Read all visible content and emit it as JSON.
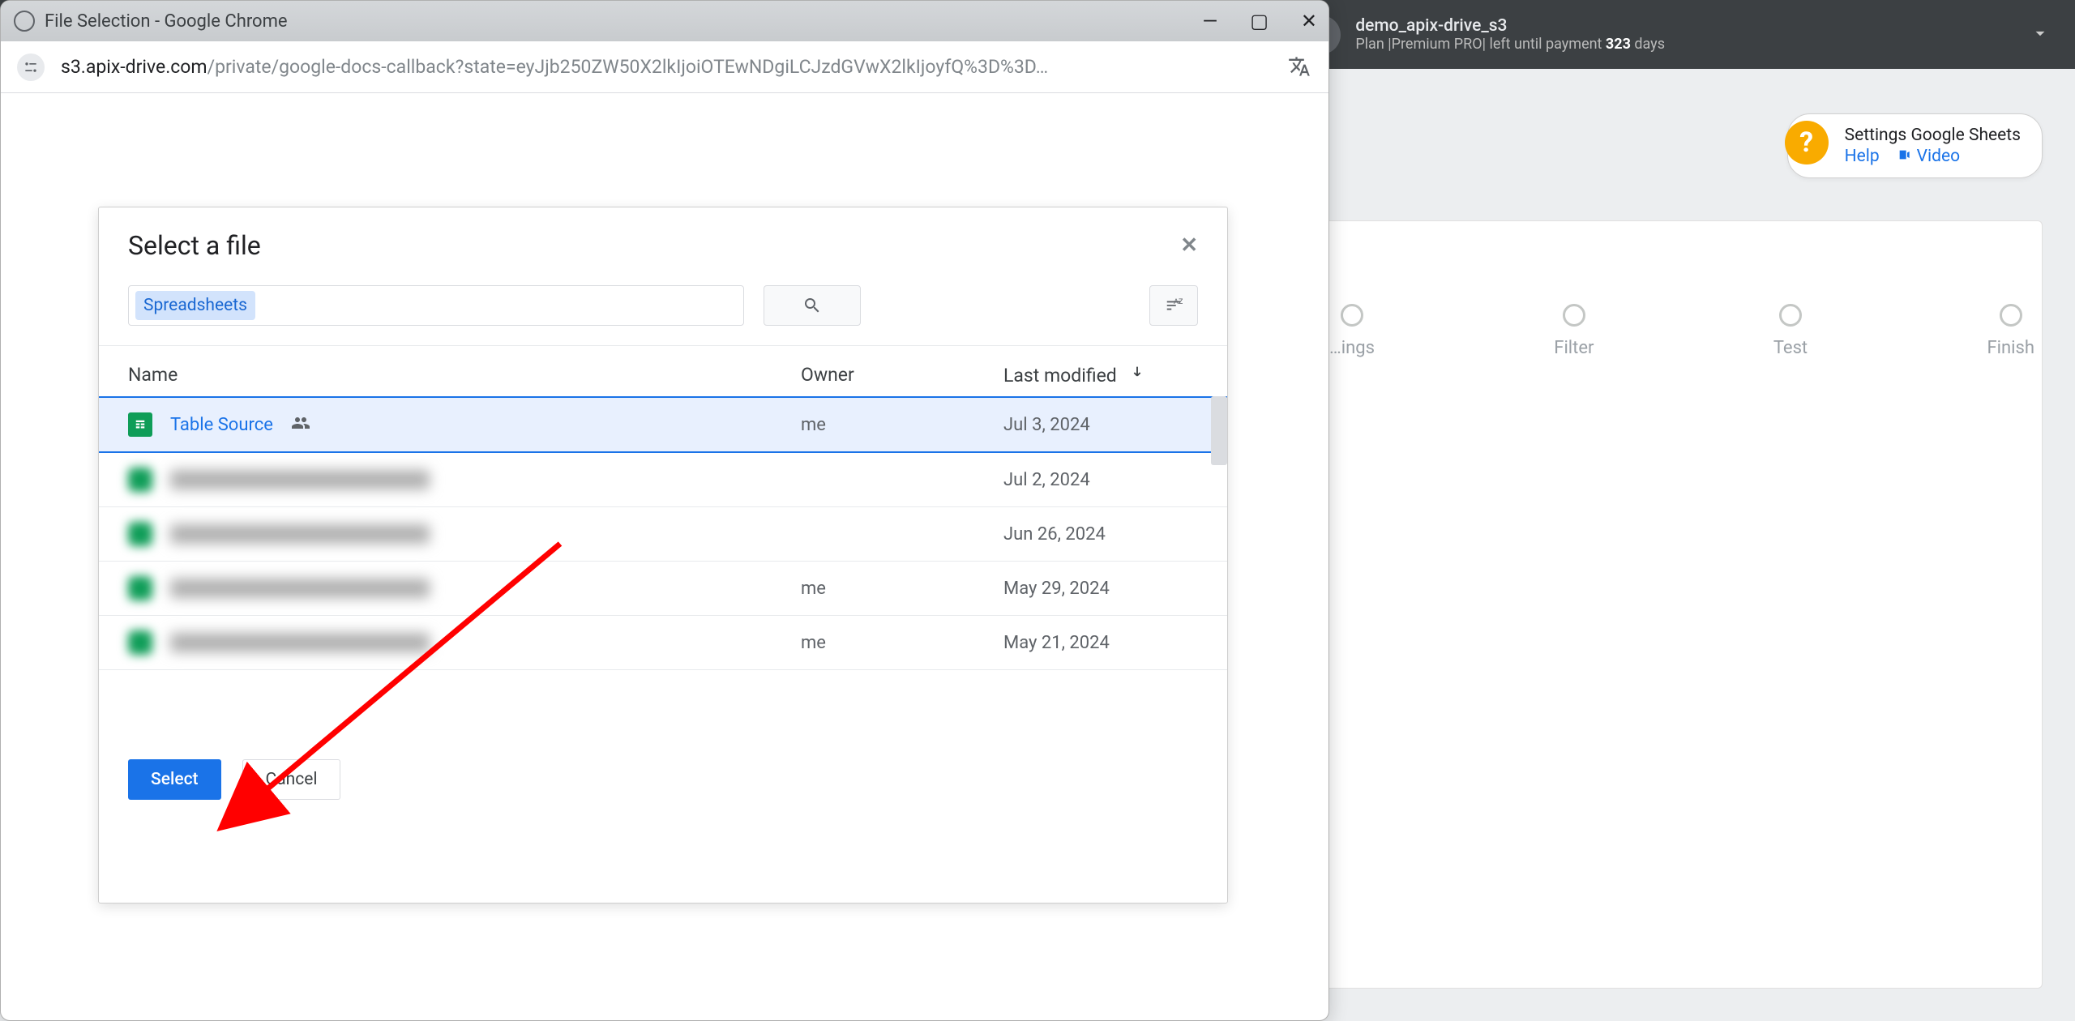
{
  "topbar": {
    "account_name": "demo_apix-drive_s3",
    "plan_prefix": "Plan |",
    "plan_name": "Premium PRO",
    "plan_mid": "| left until payment ",
    "plan_days": "323",
    "plan_suffix": " days"
  },
  "help_chip": {
    "title": "Settings Google Sheets",
    "help_label": "Help",
    "video_label": "Video"
  },
  "stepper": {
    "settings": "…ings",
    "filter": "Filter",
    "test": "Test",
    "finish": "Finish"
  },
  "chrome": {
    "window_title": "File Selection - Google Chrome",
    "url_host": "s3.apix-drive.com",
    "url_path": "/private/google-docs-callback?state=eyJjb250ZW50X2lkIjoiOTEwNDgiLCJzdGVwX2lkIjoyfQ%3D%3D…"
  },
  "picker": {
    "title": "Select a file",
    "search_chip": "Spreadsheets",
    "cols": {
      "name": "Name",
      "owner": "Owner",
      "modified": "Last modified"
    },
    "rows": [
      {
        "name": "Table Source",
        "owner": "me",
        "modified": "Jul 3, 2024",
        "selected": true,
        "shared": true
      },
      {
        "name": "",
        "owner": "",
        "modified": "Jul 2, 2024",
        "blurred": true
      },
      {
        "name": "",
        "owner": "",
        "modified": "Jun 26, 2024",
        "blurred": true
      },
      {
        "name": "",
        "owner": "me",
        "modified": "May 29, 2024",
        "blurred": true
      },
      {
        "name": "",
        "owner": "me",
        "modified": "May 21, 2024",
        "blurred": true
      }
    ],
    "select_label": "Select",
    "cancel_label": "Cancel"
  }
}
